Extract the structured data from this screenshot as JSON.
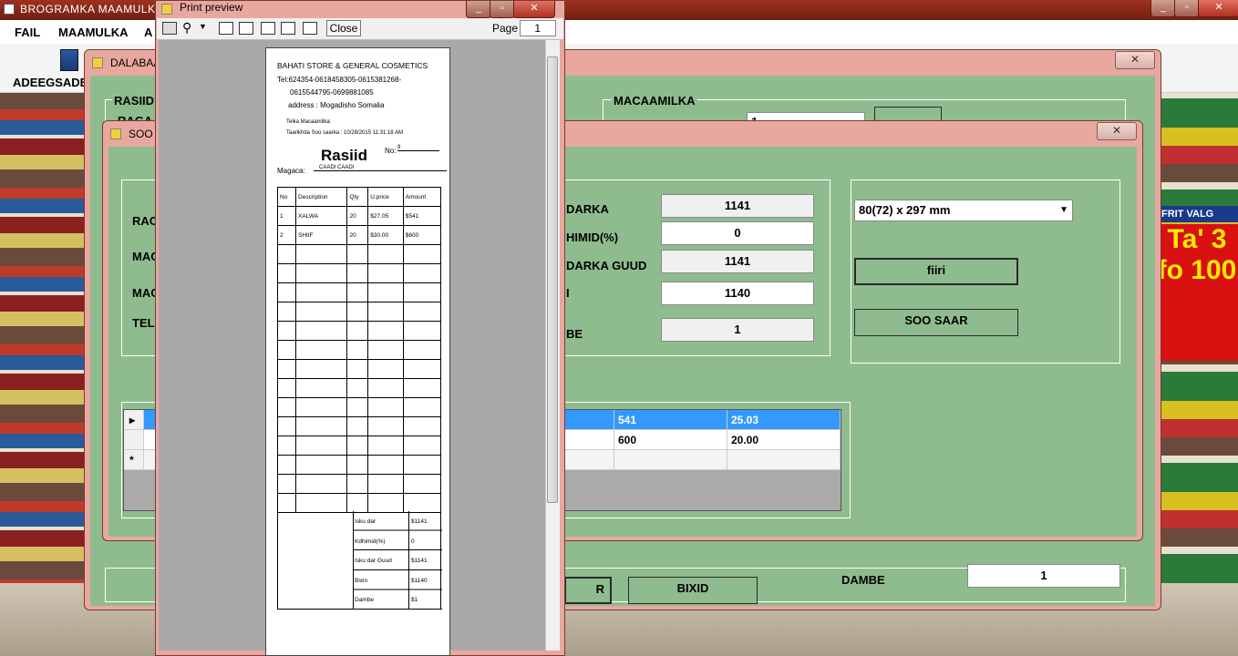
{
  "app": {
    "title": "BROGRAMKA  MAAMULKA",
    "menu": [
      "FAIL",
      "MAAMULKA",
      "A"
    ],
    "toolbar_label": "ADEEGSADE"
  },
  "background": {
    "promo_text": "Ta' 3 fo 100",
    "promo_banner": "FRIT VALG"
  },
  "dalabaad_window": {
    "title": "DALABAAD",
    "rasiid_group": "RASIID",
    "rasiid_cut": "RAGA",
    "macaamilka_group": "MACAAMILKA",
    "macaamil_input": "1",
    "dambe_label": "DAMBE",
    "dambe_value": "1",
    "bixid_button": "BIXID",
    "partial_button": "R"
  },
  "soo_window": {
    "title": "SOO",
    "left_labels": [
      "RAC",
      "MAC",
      "MAC",
      "TEL"
    ],
    "fields": [
      {
        "label": "DARKA",
        "value": "1141"
      },
      {
        "label": "HIMID(%)",
        "value": "0"
      },
      {
        "label": "DARKA GUUD",
        "value": "1141"
      },
      {
        "label": "I",
        "value": "1140"
      },
      {
        "label": "BE",
        "value": "1"
      }
    ],
    "paper_size": "80(72) x 297 mm",
    "fiiri_button": "fiiri",
    "soo_saar_button": "SOO SAAR",
    "grid_rows": [
      [
        "541",
        "25.03"
      ],
      [
        "600",
        "20.00"
      ]
    ],
    "new_row_marker": "*",
    "current_row_marker": "▸"
  },
  "print_preview": {
    "title": "Print preview",
    "close_button": "Close",
    "page_label": "Page",
    "page_value": "1"
  },
  "receipt": {
    "store_name": "BAHATI STORE & GENERAL COSMETICS",
    "tel_line1": "Tel:624354-0618458305-0615381268-",
    "tel_line2": "0615544795-0699881085",
    "address": "address : Mogadisho Somalia",
    "customer_tel": "Telka Macaamilka:",
    "date_line": "Taarikhda Soo saarka :  10/28/2015 11:31:18 AM",
    "heading": "Rasiid",
    "no_label": "No:",
    "no_value": "9",
    "magaca_label": "Magaca:",
    "magaca_value": "CAADI   CAADI",
    "columns": [
      "No",
      "Description",
      "Qty",
      "U.price",
      "Amount"
    ],
    "items": [
      [
        "1",
        "XALWA",
        "20",
        "$27.05",
        "$541"
      ],
      [
        "2",
        "SHIIF",
        "20",
        "$30.00",
        "$600"
      ]
    ],
    "totals": [
      {
        "label": "Isku dar",
        "value": "$1141"
      },
      {
        "label": "Kdhimid(%)",
        "value": "0"
      },
      {
        "label": "Isku dar Guud",
        "value": "$1141"
      },
      {
        "label": "Bixin",
        "value": "$1140"
      },
      {
        "label": "Dambe",
        "value": "$1"
      }
    ]
  }
}
